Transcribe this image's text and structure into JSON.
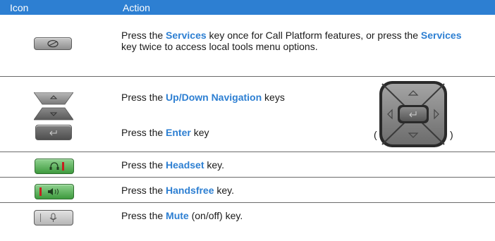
{
  "header": {
    "icon_col": "Icon",
    "action_col": "Action"
  },
  "rows": [
    {
      "icon": "services-key-icon",
      "segments": [
        {
          "t": " Press the ",
          "k": false
        },
        {
          "t": "Services",
          "k": true
        },
        {
          "t": " key once for Call Platform features, or press the ",
          "k": false
        },
        {
          "t": "Services",
          "k": true
        },
        {
          "t": " key twice to access local tools menu options.",
          "k": false
        }
      ]
    },
    {
      "icon": "up-down-navigation-keys-icon",
      "segments": [
        {
          "t": "Press the ",
          "k": false
        },
        {
          "t": "Up/Down Navigation",
          "k": true
        },
        {
          "t": " keys",
          "k": false
        }
      ]
    },
    {
      "icon": "enter-key-icon",
      "segments": [
        {
          "t": "Press the ",
          "k": false
        },
        {
          "t": "Enter",
          "k": true
        },
        {
          "t": " key",
          "k": false
        }
      ]
    },
    {
      "icon": "headset-key-icon",
      "segments": [
        {
          "t": "Press the ",
          "k": false
        },
        {
          "t": "Headset",
          "k": true
        },
        {
          "t": " key.",
          "k": false
        }
      ]
    },
    {
      "icon": "handsfree-key-icon",
      "segments": [
        {
          "t": "Press the ",
          "k": false
        },
        {
          "t": "Handsfree",
          "k": true
        },
        {
          "t": " key.",
          "k": false
        }
      ]
    },
    {
      "icon": "mute-key-icon",
      "segments": [
        {
          "t": "Press the ",
          "k": false
        },
        {
          "t": "Mute",
          "k": true
        },
        {
          "t": " (on/off) key.",
          "k": false
        }
      ]
    }
  ],
  "nav_cluster": {
    "icon": "navigation-cluster-icon",
    "open_paren": "(",
    "close_paren": ")"
  },
  "colors": {
    "header_bg": "#2d7fd2",
    "keyword": "#2d7fd2",
    "separator": "#6b6b6b"
  }
}
